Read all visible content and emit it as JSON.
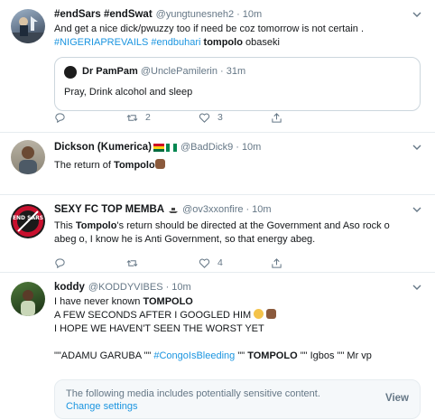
{
  "tweets": [
    {
      "name": "#endSars #endSwat",
      "handle": "@yungtunesneh2",
      "time": "10m",
      "line1": "And get a nice dick/pwuzzy too if need be coz tomorrow is not certain .",
      "hashtag1": "#NIGERIAPREVAILS",
      "hashtag2": "#endbuhari",
      "bold": "tompolo",
      "tail": "obaseki",
      "quote": {
        "name": "Dr PamPam",
        "handle": "@UnclePamilerin",
        "time": "31m",
        "text": "Pray, Drink alcohol and sleep"
      },
      "retweets": "2",
      "likes": "3"
    },
    {
      "name": "Dickson (Kumerica)",
      "handle": "@BadDick9",
      "time": "10m",
      "text_pre": "The return of",
      "bold": "Tompolo"
    },
    {
      "name": "SEXY FC TOP MEMBA",
      "handle": "@ov3xxonfire",
      "time": "10m",
      "text_pre": "This",
      "bold": "Tompolo",
      "text_post": "'s return should be directed at the Government and Aso rock o",
      "line2": "abeg o, I know he is Anti Government, so that energy abeg.",
      "likes": "4"
    },
    {
      "name": "koddy",
      "handle": "@KODDYVIBES",
      "time": "10m",
      "line1_pre": "I have never known",
      "line1_bold": "TOMPOLO",
      "line2": "A FEW SECONDS AFTER I GOOGLED HIM",
      "line3": "I HOPE WE HAVEN'T SEEN THE WORST YET",
      "line4_a": "\"\"ADAMU GARUBA \"\"",
      "line4_hashtag": "#CongoIsBleeding",
      "line4_b": "\"\"",
      "line4_bold": "TOMPOLO",
      "line4_c": "\"\" Igbos \"\" Mr vp",
      "media_notice": "The following media includes potentially sensitive content.",
      "change_settings": "Change settings",
      "view": "View"
    }
  ],
  "avatar_text": "END SARS",
  "colors": {
    "link": "#1b95e0",
    "muted": "#657786",
    "border": "#e6ecf0",
    "accent_emoji": "#8b5a3c"
  }
}
